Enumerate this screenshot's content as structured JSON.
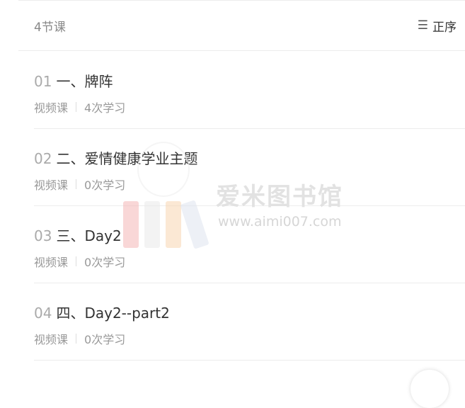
{
  "header": {
    "lesson_count": "4节课",
    "sort_label": "正序",
    "sort_icon": "sort-icon"
  },
  "lessons": [
    {
      "num": "01",
      "title": "一、牌阵",
      "type": "视频课",
      "views": "4次学习"
    },
    {
      "num": "02",
      "title": "二、爱情健康学业主题",
      "type": "视频课",
      "views": "0次学习"
    },
    {
      "num": "03",
      "title": "三、Day2",
      "type": "视频课",
      "views": "0次学习"
    },
    {
      "num": "04",
      "title": "四、Day2--part2",
      "type": "视频课",
      "views": "0次学习"
    }
  ],
  "watermark": {
    "name": "爱米图书馆",
    "url": "www.aimi007.com"
  },
  "colors": {
    "divider": "#ececec",
    "number": "#aaaaaa",
    "meta": "#999999",
    "title": "#333333"
  }
}
